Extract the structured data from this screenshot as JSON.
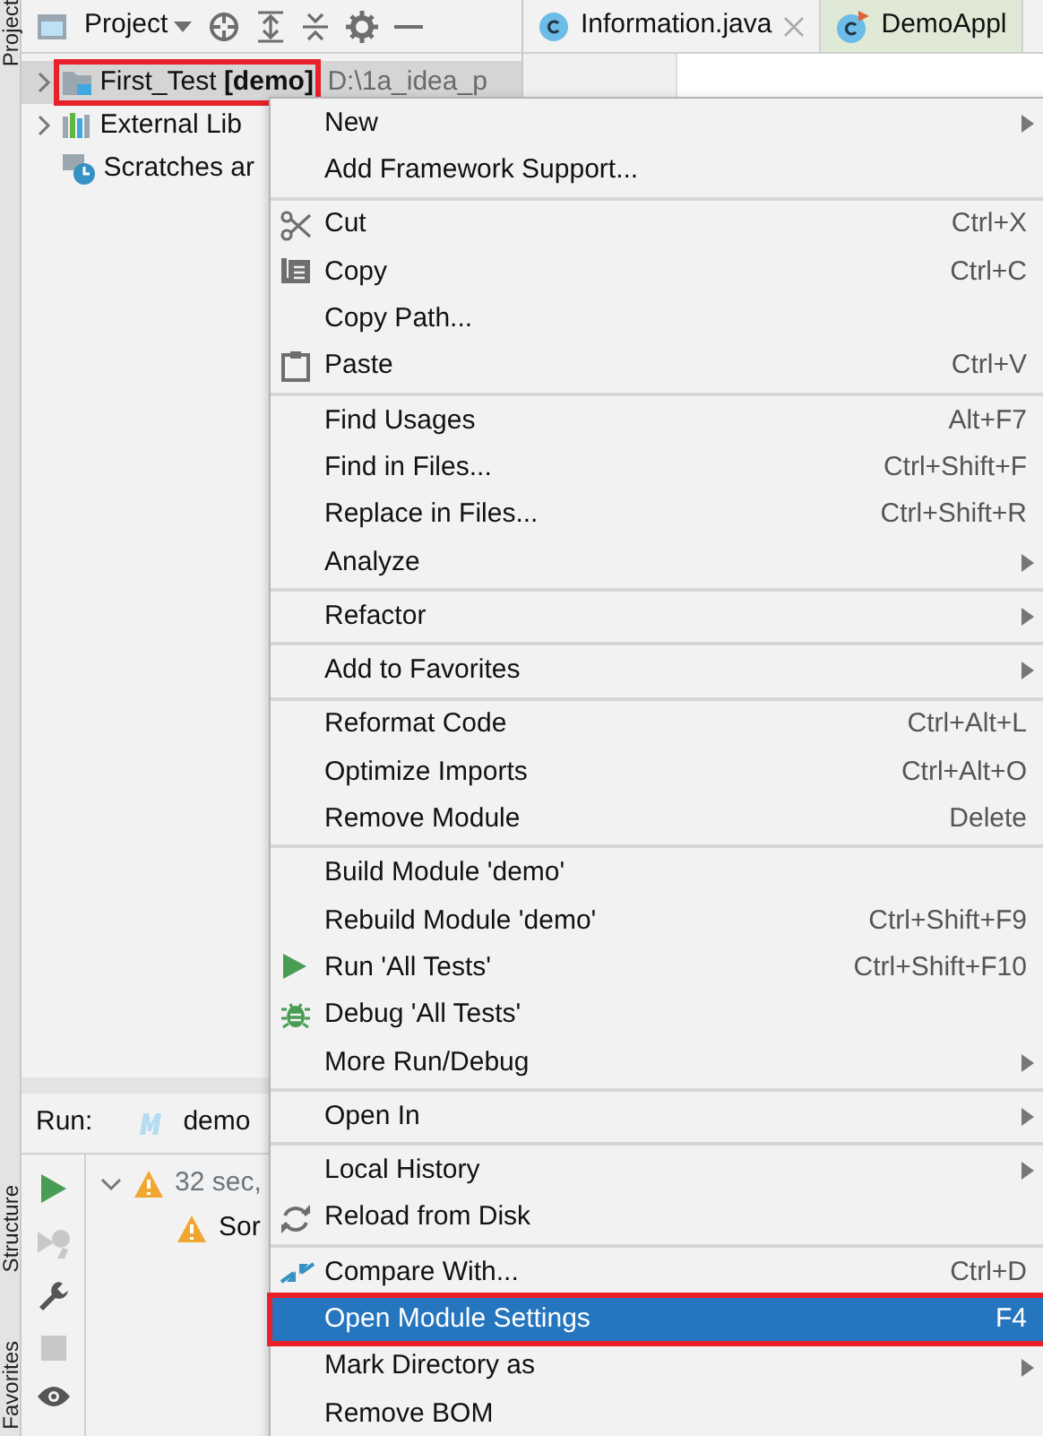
{
  "tool_stripe": {
    "top": [
      "Project"
    ],
    "bottom": [
      "Structure",
      "Favorites"
    ]
  },
  "project_panel": {
    "title": "Project",
    "tree": [
      {
        "kind": "module",
        "label": "First_Test **[demo]**",
        "path": "D:\\1a_idea_p",
        "selected": true,
        "outlined": true,
        "expandable": true
      },
      {
        "kind": "libraries",
        "label": "External Lib",
        "selected": false,
        "outlined": false,
        "expandable": true
      },
      {
        "kind": "scratches",
        "label": "Scratches ar",
        "selected": false,
        "outlined": false,
        "expandable": false
      }
    ]
  },
  "editor_tabs": [
    {
      "label": "Information.java",
      "closable": true,
      "color": "#f2f2f2",
      "kind": "class"
    },
    {
      "label": "DemoAppl",
      "closable": false,
      "color": "#dfe9d6",
      "kind": "app"
    }
  ],
  "run_panel": {
    "label": "Run:",
    "config": "demo",
    "tree": [
      {
        "text": "32 sec,",
        "expanded": true,
        "children": [
          {
            "text": "Sor"
          }
        ]
      }
    ]
  },
  "context_menu": {
    "groups": [
      [
        {
          "label": "New",
          "submenu": true,
          "selected": false,
          "outlined": false
        },
        {
          "label": "Add Framework Support...",
          "submenu": false,
          "selected": false,
          "outlined": false
        }
      ],
      [
        {
          "kind": "cut",
          "label": "Cut",
          "shortcut": "Ctrl+X",
          "submenu": false,
          "selected": false,
          "outlined": false
        },
        {
          "kind": "copy",
          "label": "Copy",
          "shortcut": "Ctrl+C",
          "submenu": false,
          "selected": false,
          "outlined": false
        },
        {
          "label": "Copy Path...",
          "submenu": false,
          "selected": false,
          "outlined": false
        },
        {
          "kind": "paste",
          "label": "Paste",
          "shortcut": "Ctrl+V",
          "submenu": false,
          "selected": false,
          "outlined": false
        }
      ],
      [
        {
          "label": "Find Usages",
          "shortcut": "Alt+F7",
          "submenu": false,
          "selected": false,
          "outlined": false
        },
        {
          "label": "Find in Files...",
          "shortcut": "Ctrl+Shift+F",
          "submenu": false,
          "selected": false,
          "outlined": false
        },
        {
          "label": "Replace in Files...",
          "shortcut": "Ctrl+Shift+R",
          "submenu": false,
          "selected": false,
          "outlined": false
        },
        {
          "label": "Analyze",
          "submenu": true,
          "selected": false,
          "outlined": false
        }
      ],
      [
        {
          "label": "Refactor",
          "submenu": true,
          "selected": false,
          "outlined": false
        }
      ],
      [
        {
          "label": "Add to Favorites",
          "submenu": true,
          "selected": false,
          "outlined": false
        }
      ],
      [
        {
          "label": "Reformat Code",
          "shortcut": "Ctrl+Alt+L",
          "submenu": false,
          "selected": false,
          "outlined": false
        },
        {
          "label": "Optimize Imports",
          "shortcut": "Ctrl+Alt+O",
          "submenu": false,
          "selected": false,
          "outlined": false
        },
        {
          "label": "Remove Module",
          "shortcut": "Delete",
          "submenu": false,
          "selected": false,
          "outlined": false
        }
      ],
      [
        {
          "label": "Build Module 'demo'",
          "submenu": false,
          "selected": false,
          "outlined": false
        },
        {
          "label": "Rebuild Module 'demo'",
          "shortcut": "Ctrl+Shift+F9",
          "submenu": false,
          "selected": false,
          "outlined": false
        },
        {
          "kind": "run",
          "label": "Run 'All Tests'",
          "shortcut": "Ctrl+Shift+F10",
          "submenu": false,
          "selected": false,
          "outlined": false
        },
        {
          "kind": "debug",
          "label": "Debug 'All Tests'",
          "submenu": false,
          "selected": false,
          "outlined": false
        },
        {
          "label": "More Run/Debug",
          "submenu": true,
          "selected": false,
          "outlined": false
        }
      ],
      [
        {
          "label": "Open In",
          "submenu": true,
          "selected": false,
          "outlined": false
        }
      ],
      [
        {
          "label": "Local History",
          "submenu": true,
          "selected": false,
          "outlined": false
        },
        {
          "kind": "reload",
          "label": "Reload from Disk",
          "submenu": false,
          "selected": false,
          "outlined": false
        }
      ],
      [
        {
          "kind": "compare",
          "label": "Compare With...",
          "shortcut": "Ctrl+D",
          "submenu": false,
          "selected": false,
          "outlined": false
        },
        {
          "label": "Open Module Settings",
          "shortcut": "F4",
          "submenu": false,
          "selected": true,
          "outlined": true
        },
        {
          "label": "Mark Directory as",
          "submenu": true,
          "selected": false,
          "outlined": false
        },
        {
          "label": "Remove BOM",
          "submenu": false,
          "selected": false,
          "outlined": false
        }
      ]
    ]
  }
}
